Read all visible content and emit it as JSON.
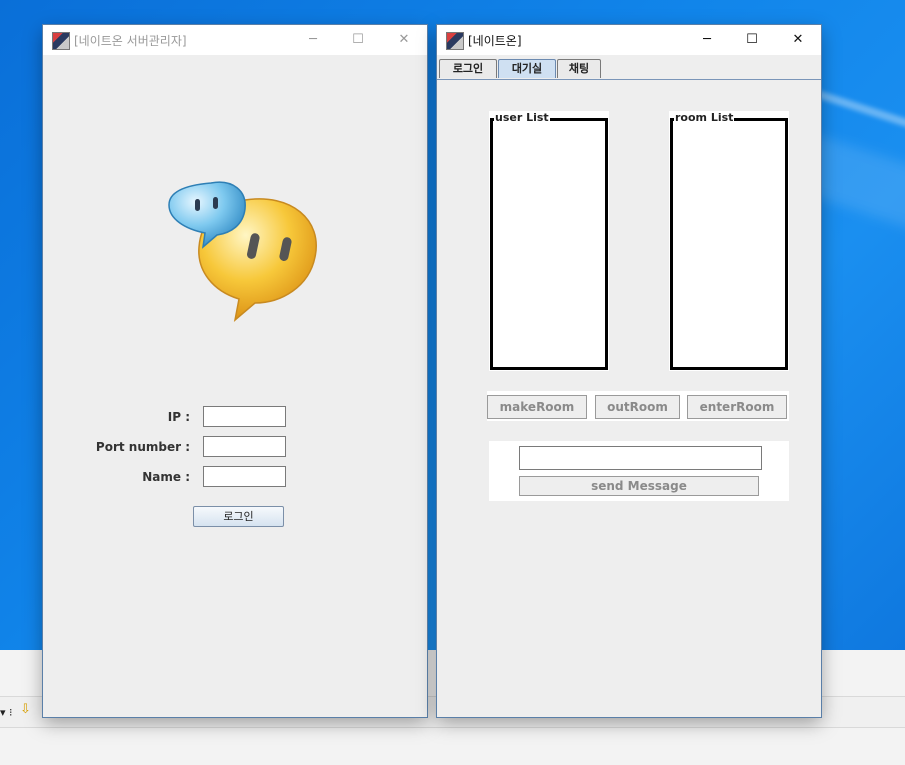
{
  "server_window": {
    "title": "[네이트온 서버관리자]",
    "minimize": "─",
    "maximize": "☐",
    "close": "✕",
    "form": {
      "ip_label": "IP :",
      "port_label": "Port number :",
      "name_label": "Name :",
      "ip_value": "",
      "port_value": "",
      "name_value": ""
    },
    "login_button": "로그인"
  },
  "client_window": {
    "title": "[네이트온]",
    "minimize": "─",
    "maximize": "☐",
    "close": "✕",
    "tabs": [
      {
        "label": "로그인"
      },
      {
        "label": "대기실"
      },
      {
        "label": "채팅"
      }
    ],
    "selected_tab": "대기실",
    "user_list_label": "user List",
    "room_list_label": "room List",
    "buttons": {
      "make_room": "makeRoom",
      "out_room": "outRoom",
      "enter_room": "enterRoom"
    },
    "message_value": "",
    "send_button": "send Message"
  },
  "colors": {
    "desktop": "#1185ea",
    "window_bg": "#eeeeee",
    "tab_selected": "#cfe0f2",
    "disabled_text": "#8a8a8a"
  }
}
